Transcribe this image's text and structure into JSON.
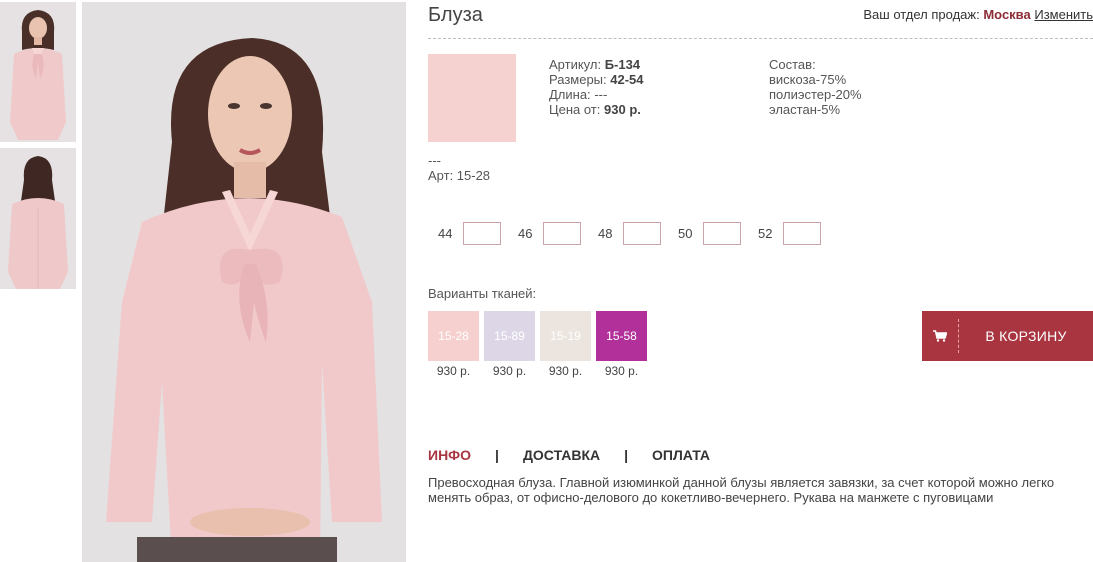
{
  "product": {
    "title": "Блуза",
    "swatch_color": "#f5d1cf"
  },
  "region": {
    "label": "Ваш отдел продаж:",
    "city": "Москва",
    "change": "Изменить"
  },
  "specs": {
    "article_label": "Артикул:",
    "article": "Б-134",
    "sizes_label": "Размеры:",
    "sizes": "42-54",
    "length_label": "Длина:",
    "length": "---",
    "price_label": "Цена от:",
    "price": "930 р."
  },
  "composition": {
    "label": "Состав:",
    "items": [
      "вискоза-75%",
      "полиэстер-20%",
      "эластан-5%"
    ]
  },
  "art": {
    "dash": "---",
    "code": "Арт: 15-28"
  },
  "sizes": [
    {
      "label": "44",
      "value": ""
    },
    {
      "label": "46",
      "value": ""
    },
    {
      "label": "48",
      "value": ""
    },
    {
      "label": "50",
      "value": ""
    },
    {
      "label": "52",
      "value": ""
    }
  ],
  "fabrics": {
    "label": "Варианты тканей:",
    "items": [
      {
        "code": "15-28",
        "price": "930 р.",
        "color": "#f6d0ce"
      },
      {
        "code": "15-89",
        "price": "930 р.",
        "color": "#dcd6e7"
      },
      {
        "code": "15-19",
        "price": "930 р.",
        "color": "#ece5df"
      },
      {
        "code": "15-58",
        "price": "930 р.",
        "color": "#b2309a"
      }
    ]
  },
  "cart": {
    "label": "В КОРЗИНУ",
    "icon": "shopping-cart-icon",
    "color": "#a83540"
  },
  "tabs": [
    {
      "label": "ИНФО",
      "active": true
    },
    {
      "label": "ДОСТАВКА",
      "active": false
    },
    {
      "label": "ОПЛАТА",
      "active": false
    }
  ],
  "tab_separator": "|",
  "description": "Превосходная блуза. Главной изюминкой данной блузы является завязки, за счет которой можно легко менять образ, от офисно-делового до кокетливо-вечернего. Рукава на манжете с пуговицами"
}
